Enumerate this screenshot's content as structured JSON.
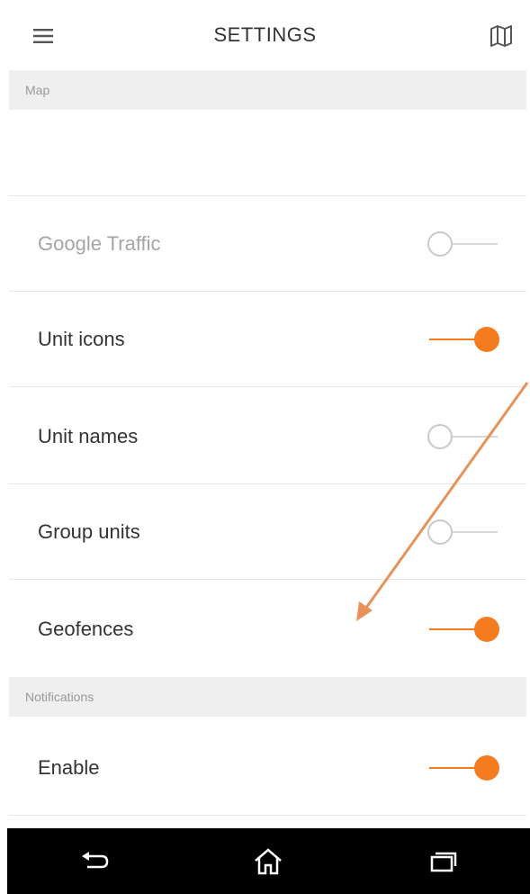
{
  "header": {
    "title": "SETTINGS",
    "menu_icon": "hamburger-menu-icon",
    "map_icon": "map-icon"
  },
  "sections": {
    "map": {
      "label": "Map",
      "items": [
        {
          "label": "Google Traffic",
          "state": "off",
          "enabled": false
        },
        {
          "label": "Unit icons",
          "state": "on",
          "enabled": true
        },
        {
          "label": "Unit names",
          "state": "off",
          "enabled": true
        },
        {
          "label": "Group units",
          "state": "off",
          "enabled": true
        },
        {
          "label": "Geofences",
          "state": "on",
          "enabled": true
        }
      ]
    },
    "notifications": {
      "label": "Notifications",
      "items": [
        {
          "label": "Enable",
          "state": "on",
          "enabled": true
        }
      ]
    }
  },
  "navbar": {
    "back_icon": "back-icon",
    "home_icon": "home-icon",
    "recents_icon": "recent-apps-icon"
  },
  "colors": {
    "accent": "#f57b1f",
    "section_bg": "#efefef",
    "navbar_bg": "#000000"
  }
}
